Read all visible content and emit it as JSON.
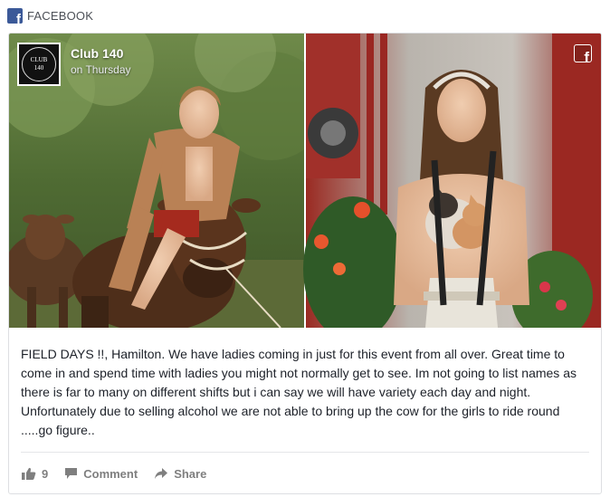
{
  "widget": {
    "title": "FACEBOOK",
    "logo_icon": "facebook-f-icon"
  },
  "post": {
    "page_name": "Club 140",
    "time": "on Thursday",
    "avatar": {
      "line1": "CLUB",
      "line2": "140"
    },
    "corner_icon": "facebook-f-icon",
    "text": "FIELD DAYS !!, Hamilton. We have ladies coming in just for this event from all over. Great time to come in and spend time with ladies you might not normally get to see. Im not going to list names as there is far to many on different shifts but i can say we will have variety each day and night. Unfortunately due to selling alcohol we are not able to bring up the cow for the girls to ride round .....go figure..",
    "actions": {
      "like_count": "9",
      "comment_label": "Comment",
      "share_label": "Share"
    }
  },
  "colors": {
    "facebook_blue": "#3b5998",
    "action_gray": "#7f7f7f",
    "text": "#1d2129"
  }
}
